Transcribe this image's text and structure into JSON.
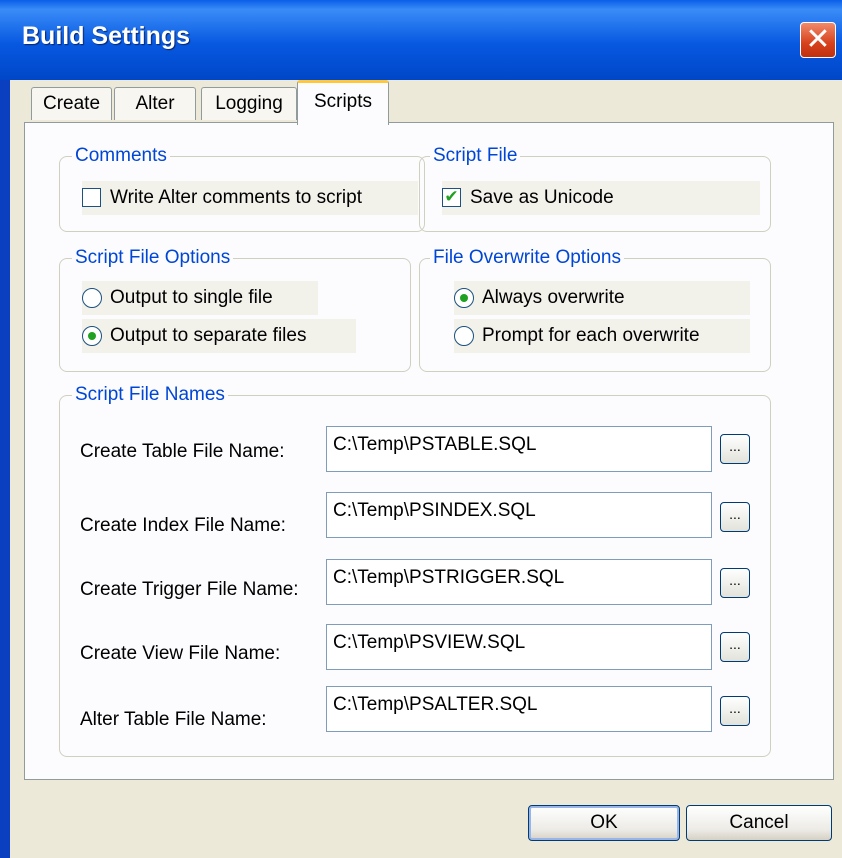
{
  "window": {
    "title": "Build Settings"
  },
  "tabs": [
    {
      "label": "Create"
    },
    {
      "label": "Alter"
    },
    {
      "label": "Logging"
    },
    {
      "label": "Scripts"
    }
  ],
  "active_tab": "Scripts",
  "comments": {
    "label": "Comments",
    "write_alter_comments": {
      "label": "Write Alter comments to script",
      "checked": false
    }
  },
  "script_file": {
    "label": "Script File",
    "save_as_unicode": {
      "label": "Save as Unicode",
      "checked": true
    }
  },
  "script_file_options": {
    "label": "Script File Options",
    "options": [
      {
        "label": "Output to single file",
        "selected": false
      },
      {
        "label": "Output to separate files",
        "selected": true
      }
    ]
  },
  "file_overwrite_options": {
    "label": "File Overwrite Options",
    "options": [
      {
        "label": "Always overwrite",
        "selected": true
      },
      {
        "label": "Prompt for each overwrite",
        "selected": false
      }
    ]
  },
  "script_file_names": {
    "label": "Script File Names",
    "fields": [
      {
        "label": "Create Table File Name:",
        "value": "C:\\Temp\\PSTABLE.SQL"
      },
      {
        "label": "Create Index File Name:",
        "value": "C:\\Temp\\PSINDEX.SQL"
      },
      {
        "label": "Create Trigger File Name:",
        "value": "C:\\Temp\\PSTRIGGER.SQL"
      },
      {
        "label": "Create View File Name:",
        "value": "C:\\Temp\\PSVIEW.SQL"
      },
      {
        "label": "Alter Table File Name:",
        "value": "C:\\Temp\\PSALTER.SQL"
      }
    ],
    "browse_label": "..."
  },
  "buttons": {
    "ok": "OK",
    "cancel": "Cancel"
  },
  "close_glyph": "✕",
  "check_glyph": "✔",
  "colors": {
    "accent": "#0046d5",
    "check": "#21a121",
    "titlebar": "#0758e0"
  }
}
